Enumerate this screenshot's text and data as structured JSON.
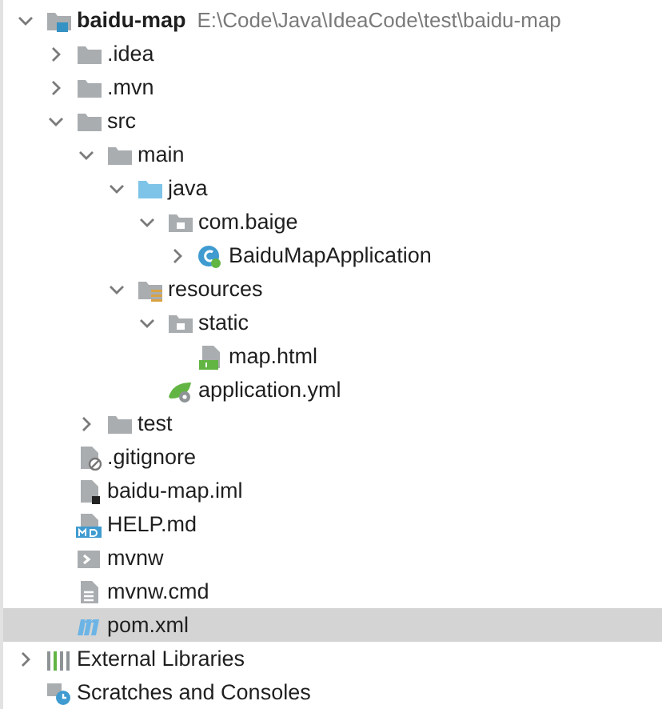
{
  "project_tree": [
    {
      "kind": "module",
      "name": "baidu-map",
      "path": "E:\\Code\\Java\\IdeaCode\\test\\baidu-map",
      "expanded": true,
      "selected": false,
      "children": [
        {
          "kind": "folder",
          "name": ".idea",
          "expanded": false,
          "selected": false
        },
        {
          "kind": "folder",
          "name": ".mvn",
          "expanded": false,
          "selected": false
        },
        {
          "kind": "folder",
          "name": "src",
          "expanded": true,
          "selected": false,
          "children": [
            {
              "kind": "folder",
              "name": "main",
              "expanded": true,
              "selected": false,
              "children": [
                {
                  "kind": "source-folder",
                  "name": "java",
                  "expanded": true,
                  "selected": false,
                  "children": [
                    {
                      "kind": "package",
                      "name": "com.baige",
                      "expanded": true,
                      "selected": false,
                      "children": [
                        {
                          "kind": "class",
                          "name": "BaiduMapApplication",
                          "expanded": false,
                          "selected": false
                        }
                      ]
                    }
                  ]
                },
                {
                  "kind": "resources-folder",
                  "name": "resources",
                  "expanded": true,
                  "selected": false,
                  "children": [
                    {
                      "kind": "package",
                      "name": "static",
                      "expanded": true,
                      "selected": false,
                      "children": [
                        {
                          "kind": "html",
                          "name": "map.html",
                          "selected": false
                        }
                      ]
                    },
                    {
                      "kind": "yml",
                      "name": "application.yml",
                      "selected": false
                    }
                  ]
                }
              ]
            },
            {
              "kind": "folder",
              "name": "test",
              "expanded": false,
              "selected": false
            }
          ]
        },
        {
          "kind": "gitignore",
          "name": ".gitignore",
          "selected": false
        },
        {
          "kind": "iml",
          "name": "baidu-map.iml",
          "selected": false
        },
        {
          "kind": "markdown",
          "name": "HELP.md",
          "selected": false
        },
        {
          "kind": "script",
          "name": "mvnw",
          "selected": false
        },
        {
          "kind": "text",
          "name": "mvnw.cmd",
          "selected": false
        },
        {
          "kind": "maven",
          "name": "pom.xml",
          "selected": true
        }
      ]
    },
    {
      "kind": "libraries",
      "name": "External Libraries",
      "expanded": false,
      "selected": false
    },
    {
      "kind": "scratches",
      "name": "Scratches and Consoles",
      "selected": false
    }
  ]
}
